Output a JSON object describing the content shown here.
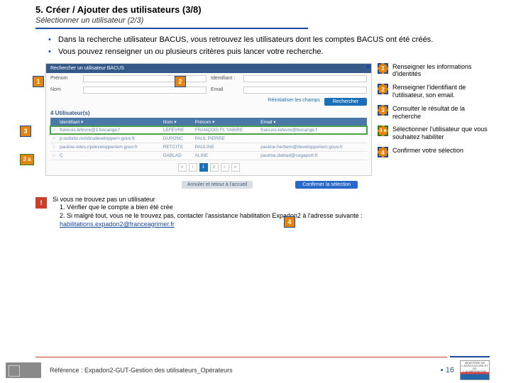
{
  "title": "5. Créer / Ajouter des utilisateurs (3/8)",
  "subtitle": "Sélectionner un utilisateur (2/3)",
  "bullets": [
    "Dans la recherche utilisateur BACUS, vous retrouvez les utilisateurs dont les comptes BACUS ont été créés.",
    "Vous pouvez renseigner un ou plusieurs critères puis lancer votre recherche."
  ],
  "screenshot": {
    "header": "Rechercher un utilisateur BACUS",
    "dot": "x",
    "labels": {
      "prenom": "Prénom",
      "nom": "Nom",
      "identifiant": "Identifiant :",
      "email": "Email"
    },
    "reset": "Réinitialiser les champs",
    "search": "Rechercher",
    "count": "4 Utilisateur(s)",
    "cols": {
      "id": "Identifiant ▾",
      "nom": "Nom ▾",
      "prenom": "Prénom ▾",
      "email": "Email ▾"
    },
    "rows": [
      {
        "id": "francois.lefevre@1.bocange.f",
        "nom": "LEFEVRE",
        "prenom": "FRANÇOIS FL YABIRE",
        "email": "francois.lefevre@bocange.f",
        "sel": true
      },
      {
        "id": "p.outlabs.rezidzudeveloppern.gouv.fr",
        "nom": "DUPONC",
        "prenom": "PAUL PIERRE",
        "email": ""
      },
      {
        "id": "pauline.retes.npdevelopperiem.gouv.fr",
        "nom": "RETCITS",
        "prenom": "PAULINE",
        "email": "pauline.herbern@developperiem.gouv.fr"
      },
      {
        "id": "C",
        "nom": "DABLAD",
        "prenom": "ALINE",
        "email": "paulma.dablad@cegaport.fr"
      }
    ],
    "pages": [
      "«",
      "‹",
      "1",
      "2",
      "›",
      "»"
    ],
    "active_page": "1",
    "cancel": "Annuler et retour à l'accueil",
    "confirm": "Confirmer la sélection"
  },
  "markers": {
    "m1": "1",
    "m2": "2",
    "m3": "3",
    "m3a": "3 a",
    "m4": "4"
  },
  "legend": [
    {
      "num": "1",
      "txt": "Renseigner les informations d'identités"
    },
    {
      "num": "2",
      "txt": "Renseigner l'identifiant de l'utilisateur, son email."
    },
    {
      "num": "3",
      "txt": "Consulter le résultat de la recherche"
    },
    {
      "num": "3 a",
      "txt": "Sélectionner l'utilisateur que vous souhaitez habiliter",
      "green": true
    },
    {
      "num": "4",
      "txt": "Confirmer votre sélection"
    }
  ],
  "note": {
    "icon": "!",
    "title": "Si vous ne trouvez pas un utilisateur",
    "items": [
      "1.    Vérifier que le compte a bien été crée",
      "2.    Si malgré tout, vous ne le trouvez pas, contacter l'assistance habilitation Expadon2 à l'adresse suivante : "
    ],
    "link": "habilitations.expadon2@franceagrimer.fr"
  },
  "footer": {
    "ref": "Référence : Expadon2-GUT-Gestion des utilisateurs_Opérateurs",
    "page": "16",
    "min": "MINISTÈRE DE L'AGRICULTURE ET DE L'ALIMENTATION"
  }
}
